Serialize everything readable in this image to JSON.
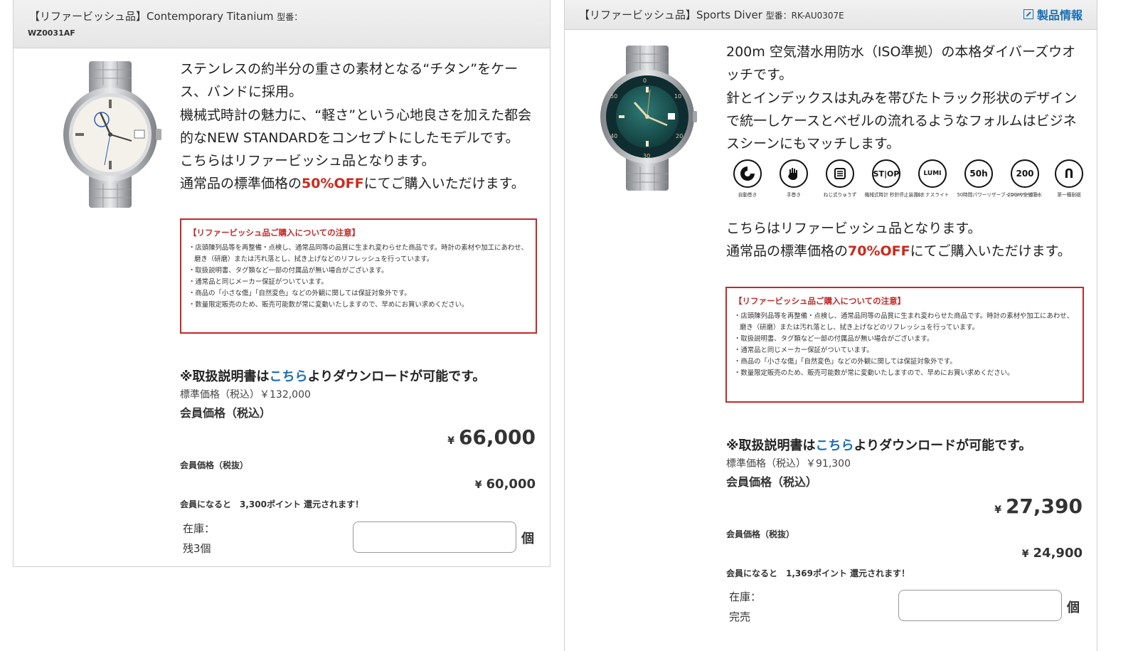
{
  "products": [
    {
      "title": "【リファービッシュ品】Contemporary Titanium",
      "model_label": "型番：",
      "model": "WZ0031AF",
      "desc_lines": [
        "ステンレスの約半分の重さの素材となる“チタン”をケース、バンドに採用。",
        "機械式時計の魅力に、“軽さ”という心地良さを加えた都会的なNEW STANDARDをコンセプトにしたモデルです。",
        "こちらはリファービッシュ品となります。"
      ],
      "offer_pre": "通常品の標準価格の",
      "offer_pct": "50%OFF",
      "offer_post": "にてご購入いただけます。",
      "notice": {
        "title": "【リファービッシュ品ご購入についての注意】",
        "items": [
          "店頭陳列品等を再整備・点検し、通常品同等の品質に生まれ変わらせた商品です。時計の素材や加工にあわせ、磨き（研磨）または汚れ落とし、拭き上げなどのリフレッシュを行っています。",
          "取扱説明書、タグ類など一部の付属品が無い場合がございます。",
          "通常品と同じメーカー保証がついています。",
          "商品の「小さな傷」「自然変色」などの外観に関しては保証対象外です。",
          "数量限定販売のため、販売可能数が常に変動いたしますので、早めにお買い求めください。"
        ]
      },
      "manual_pre": "※取扱説明書は",
      "manual_link": "こちら",
      "manual_post": "よりダウンロードが可能です。",
      "std_price": "標準価格（税込）￥132,000",
      "member_price_label": "会員価格（税込）",
      "yen": "¥",
      "member_price": "66,000",
      "member_price_ex_label": "会員価格（税抜）",
      "member_price_ex": "60,000",
      "points": "会員になると　3,300ポイント 還元されます！",
      "stock_label": "在庫：",
      "stock_value": "残3個",
      "qty_value": "",
      "unit": "個"
    },
    {
      "title": "【リファービッシュ品】Sports Diver",
      "model_label": "型番：",
      "model": "RK-AU0307E",
      "link_label": "製品情報",
      "desc_lines": [
        "200m 空気潜水用防水（ISO準拠）の本格ダイバーズウオッチです。",
        "針とインデックスは丸みを帯びたトラック形状のデザインで統一しケースとベゼルの流れるようなフォルムはビジネスシーンにもマッチします。"
      ],
      "features": [
        {
          "icon": "auto-winding-icon",
          "glyph": "",
          "label": "自動巻き"
        },
        {
          "icon": "hand-winding-icon",
          "glyph": "",
          "label": "手巻き"
        },
        {
          "icon": "screw-crown-icon",
          "glyph": "",
          "label": "ねじ式りゅうず"
        },
        {
          "icon": "stop-seconds-icon",
          "glyph": "ST|OP",
          "label": "機械式時計 秒針停止装置付"
        },
        {
          "icon": "lumi-icon",
          "glyph": "LUMI",
          "label": "ルミナスライト"
        },
        {
          "icon": "power-reserve-icon",
          "glyph": "50h",
          "label": "50時間パワーリザーブインジケーター"
        },
        {
          "icon": "water-200m-icon",
          "glyph": "200",
          "label": "200m 空気潜水"
        },
        {
          "icon": "first-class-icon",
          "glyph": "Ո",
          "label": "第一種耐磁"
        }
      ],
      "offer_intro": "こちらはリファービッシュ品となります。",
      "offer_pre": "通常品の標準価格の",
      "offer_pct": "70%OFF",
      "offer_post": "にてご購入いただけます。",
      "notice": {
        "title": "【リファービッシュ品ご購入についての注意】",
        "items": [
          "店頭陳列品等を再整備・点検し、通常品同等の品質に生まれ変わらせた商品です。時計の素材や加工にあわせ、磨き（研磨）または汚れ落とし、拭き上げなどのリフレッシュを行っています。",
          "取扱説明書、タグ類など一部の付属品が無い場合がございます。",
          "通常品と同じメーカー保証がついています。",
          "商品の「小さな傷」「自然変色」などの外観に関しては保証対象外です。",
          "数量限定販売のため、販売可能数が常に変動いたしますので、早めにお買い求めください。"
        ]
      },
      "manual_pre": "※取扱説明書は",
      "manual_link": "こちら",
      "manual_post": "よりダウンロードが可能です。",
      "std_price": "標準価格（税込）￥91,300",
      "member_price_label": "会員価格（税込）",
      "yen": "¥",
      "member_price": "27,390",
      "member_price_ex_label": "会員価格（税抜）",
      "member_price_ex": "24,900",
      "points": "会員になると　1,369ポイント 還元されます！",
      "stock_label": "在庫：",
      "stock_value": "完売",
      "qty_value": "",
      "unit": "個"
    }
  ]
}
